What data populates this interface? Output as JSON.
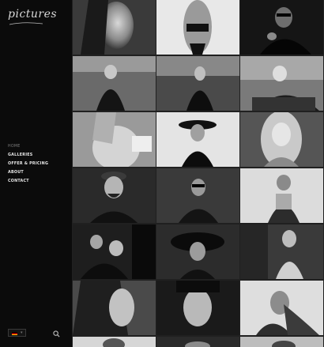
{
  "site": {
    "logo_text": "pictures"
  },
  "nav": {
    "items": [
      {
        "label": "HOME",
        "active": true
      },
      {
        "label": "GALLERIES",
        "active": false
      },
      {
        "label": "OFFER & PRICING",
        "active": false
      },
      {
        "label": "ABOUT",
        "active": false
      },
      {
        "label": "CONTACT",
        "active": false
      }
    ]
  },
  "footer": {
    "language_flag": "german-flag-icon",
    "search_icon": "search-icon"
  },
  "colors": {
    "background": "#0b0b0b",
    "nav_text": "#e6e6e6",
    "nav_active": "#7c7c7c",
    "grid_gap": "#202020"
  }
}
